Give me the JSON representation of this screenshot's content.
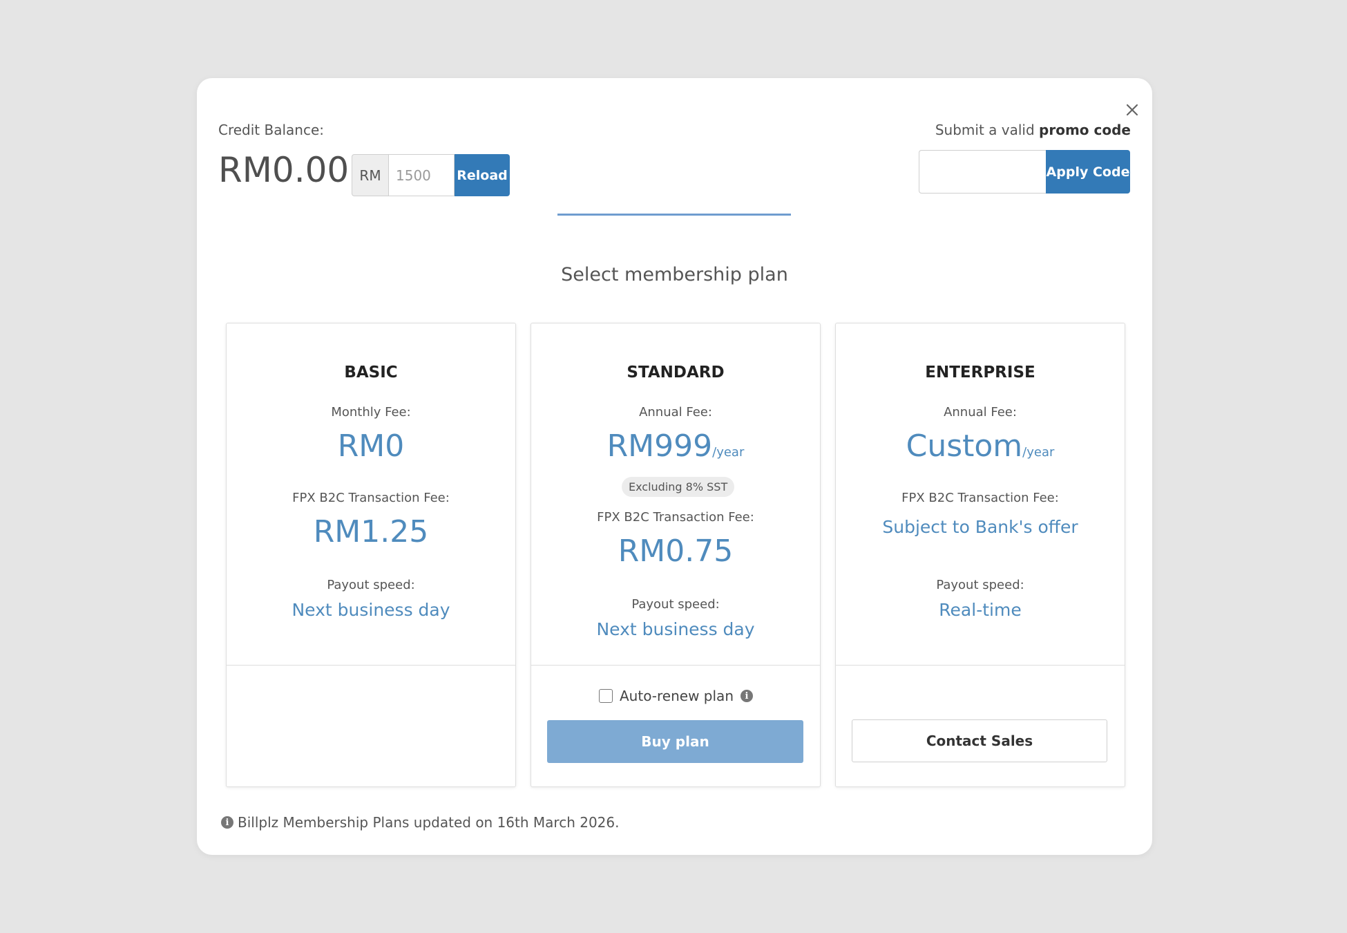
{
  "header": {
    "credit_label": "Credit Balance:",
    "balance": "RM0.00",
    "reload": {
      "currency": "RM",
      "placeholder": "1500",
      "button": "Reload"
    },
    "promo": {
      "label_prefix": "Submit a valid ",
      "label_bold": "promo code",
      "input_value": "",
      "button": "Apply Code"
    }
  },
  "section_title": "Select membership plan",
  "plans": [
    {
      "name": "BASIC",
      "fee_label": "Monthly Fee:",
      "fee": "RM0",
      "fee_unit": "",
      "txn_label": "FPX B2C Transaction Fee:",
      "txn_fee": "RM1.25",
      "payout_label": "Payout speed:",
      "payout": "Next business day"
    },
    {
      "name": "STANDARD",
      "fee_label": "Annual Fee:",
      "fee": "RM999",
      "fee_unit": "/year",
      "badge": "Excluding 8% SST",
      "txn_label": "FPX B2C Transaction Fee:",
      "txn_fee": "RM0.75",
      "payout_label": "Payout speed:",
      "payout": "Next business day",
      "auto_renew_label": "Auto-renew plan",
      "auto_renew_checked": false,
      "button": "Buy plan"
    },
    {
      "name": "ENTERPRISE",
      "fee_label": "Annual Fee:",
      "fee": "Custom",
      "fee_unit": "/year",
      "txn_label": "FPX B2C Transaction Fee:",
      "txn_fee": "Subject to Bank's offer",
      "payout_label": "Payout speed:",
      "payout": "Real-time",
      "button": "Contact Sales"
    }
  ],
  "footnote": "Billplz Membership Plans updated on 16th March 2026.",
  "colors": {
    "primary": "#337ab7",
    "accent_text": "#4f8bbd",
    "buy_button": "#7eaad3",
    "background": "#e5e5e5"
  }
}
